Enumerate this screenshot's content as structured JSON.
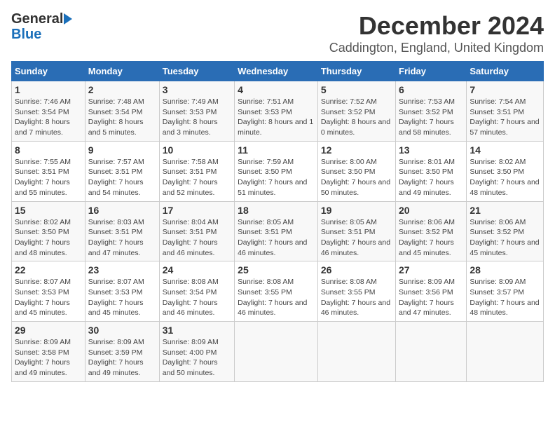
{
  "header": {
    "logo_top": "General",
    "logo_bottom": "Blue",
    "title": "December 2024",
    "subtitle": "Caddington, England, United Kingdom"
  },
  "calendar": {
    "days_of_week": [
      "Sunday",
      "Monday",
      "Tuesday",
      "Wednesday",
      "Thursday",
      "Friday",
      "Saturday"
    ],
    "weeks": [
      [
        {
          "day": "1",
          "sunrise": "7:46 AM",
          "sunset": "3:54 PM",
          "daylight": "8 hours and 7 minutes."
        },
        {
          "day": "2",
          "sunrise": "7:48 AM",
          "sunset": "3:54 PM",
          "daylight": "8 hours and 5 minutes."
        },
        {
          "day": "3",
          "sunrise": "7:49 AM",
          "sunset": "3:53 PM",
          "daylight": "8 hours and 3 minutes."
        },
        {
          "day": "4",
          "sunrise": "7:51 AM",
          "sunset": "3:53 PM",
          "daylight": "8 hours and 1 minute."
        },
        {
          "day": "5",
          "sunrise": "7:52 AM",
          "sunset": "3:52 PM",
          "daylight": "8 hours and 0 minutes."
        },
        {
          "day": "6",
          "sunrise": "7:53 AM",
          "sunset": "3:52 PM",
          "daylight": "7 hours and 58 minutes."
        },
        {
          "day": "7",
          "sunrise": "7:54 AM",
          "sunset": "3:51 PM",
          "daylight": "7 hours and 57 minutes."
        }
      ],
      [
        {
          "day": "8",
          "sunrise": "7:55 AM",
          "sunset": "3:51 PM",
          "daylight": "7 hours and 55 minutes."
        },
        {
          "day": "9",
          "sunrise": "7:57 AM",
          "sunset": "3:51 PM",
          "daylight": "7 hours and 54 minutes."
        },
        {
          "day": "10",
          "sunrise": "7:58 AM",
          "sunset": "3:51 PM",
          "daylight": "7 hours and 52 minutes."
        },
        {
          "day": "11",
          "sunrise": "7:59 AM",
          "sunset": "3:50 PM",
          "daylight": "7 hours and 51 minutes."
        },
        {
          "day": "12",
          "sunrise": "8:00 AM",
          "sunset": "3:50 PM",
          "daylight": "7 hours and 50 minutes."
        },
        {
          "day": "13",
          "sunrise": "8:01 AM",
          "sunset": "3:50 PM",
          "daylight": "7 hours and 49 minutes."
        },
        {
          "day": "14",
          "sunrise": "8:02 AM",
          "sunset": "3:50 PM",
          "daylight": "7 hours and 48 minutes."
        }
      ],
      [
        {
          "day": "15",
          "sunrise": "8:02 AM",
          "sunset": "3:50 PM",
          "daylight": "7 hours and 48 minutes."
        },
        {
          "day": "16",
          "sunrise": "8:03 AM",
          "sunset": "3:51 PM",
          "daylight": "7 hours and 47 minutes."
        },
        {
          "day": "17",
          "sunrise": "8:04 AM",
          "sunset": "3:51 PM",
          "daylight": "7 hours and 46 minutes."
        },
        {
          "day": "18",
          "sunrise": "8:05 AM",
          "sunset": "3:51 PM",
          "daylight": "7 hours and 46 minutes."
        },
        {
          "day": "19",
          "sunrise": "8:05 AM",
          "sunset": "3:51 PM",
          "daylight": "7 hours and 46 minutes."
        },
        {
          "day": "20",
          "sunrise": "8:06 AM",
          "sunset": "3:52 PM",
          "daylight": "7 hours and 45 minutes."
        },
        {
          "day": "21",
          "sunrise": "8:06 AM",
          "sunset": "3:52 PM",
          "daylight": "7 hours and 45 minutes."
        }
      ],
      [
        {
          "day": "22",
          "sunrise": "8:07 AM",
          "sunset": "3:53 PM",
          "daylight": "7 hours and 45 minutes."
        },
        {
          "day": "23",
          "sunrise": "8:07 AM",
          "sunset": "3:53 PM",
          "daylight": "7 hours and 45 minutes."
        },
        {
          "day": "24",
          "sunrise": "8:08 AM",
          "sunset": "3:54 PM",
          "daylight": "7 hours and 46 minutes."
        },
        {
          "day": "25",
          "sunrise": "8:08 AM",
          "sunset": "3:55 PM",
          "daylight": "7 hours and 46 minutes."
        },
        {
          "day": "26",
          "sunrise": "8:08 AM",
          "sunset": "3:55 PM",
          "daylight": "7 hours and 46 minutes."
        },
        {
          "day": "27",
          "sunrise": "8:09 AM",
          "sunset": "3:56 PM",
          "daylight": "7 hours and 47 minutes."
        },
        {
          "day": "28",
          "sunrise": "8:09 AM",
          "sunset": "3:57 PM",
          "daylight": "7 hours and 48 minutes."
        }
      ],
      [
        {
          "day": "29",
          "sunrise": "8:09 AM",
          "sunset": "3:58 PM",
          "daylight": "7 hours and 49 minutes."
        },
        {
          "day": "30",
          "sunrise": "8:09 AM",
          "sunset": "3:59 PM",
          "daylight": "7 hours and 49 minutes."
        },
        {
          "day": "31",
          "sunrise": "8:09 AM",
          "sunset": "4:00 PM",
          "daylight": "7 hours and 50 minutes."
        },
        {
          "day": "",
          "sunrise": "",
          "sunset": "",
          "daylight": ""
        },
        {
          "day": "",
          "sunrise": "",
          "sunset": "",
          "daylight": ""
        },
        {
          "day": "",
          "sunrise": "",
          "sunset": "",
          "daylight": ""
        },
        {
          "day": "",
          "sunrise": "",
          "sunset": "",
          "daylight": ""
        }
      ]
    ]
  }
}
